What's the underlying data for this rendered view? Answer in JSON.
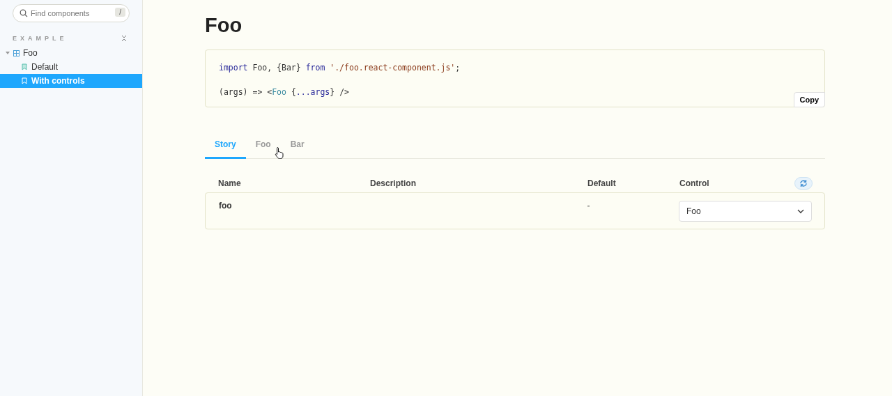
{
  "sidebar": {
    "search": {
      "placeholder": "Find components",
      "shortcut": "/"
    },
    "section": "EXAMPLE",
    "tree": [
      {
        "label": "Foo",
        "expanded": true,
        "children": [
          {
            "label": "Default",
            "selected": false
          },
          {
            "label": "With controls",
            "selected": true
          }
        ]
      }
    ]
  },
  "title": "Foo",
  "code": {
    "lines": [
      [
        {
          "kind": "keyword",
          "text": "import"
        },
        {
          "kind": "plain",
          "text": " Foo, {Bar} "
        },
        {
          "kind": "keyword",
          "text": "from"
        },
        {
          "kind": "string",
          "text": " './foo.react-component.js'"
        },
        {
          "kind": "plain",
          "text": ";"
        }
      ],
      [
        {
          "kind": "plain",
          "text": "(args) => <"
        },
        {
          "kind": "tag",
          "text": "Foo"
        },
        {
          "kind": "plain",
          "text": " {"
        },
        {
          "kind": "keyword",
          "text": "...args"
        },
        {
          "kind": "plain",
          "text": "} />"
        }
      ]
    ],
    "copy": "Copy"
  },
  "tabs": [
    {
      "label": "Story",
      "selected": true
    },
    {
      "label": "Foo",
      "selected": false
    },
    {
      "label": "Bar",
      "selected": false
    }
  ],
  "table": {
    "columns": [
      "Name",
      "Description",
      "Default",
      "Control"
    ],
    "rows": [
      {
        "name": "foo",
        "default": "-",
        "control": "Foo"
      }
    ]
  }
}
